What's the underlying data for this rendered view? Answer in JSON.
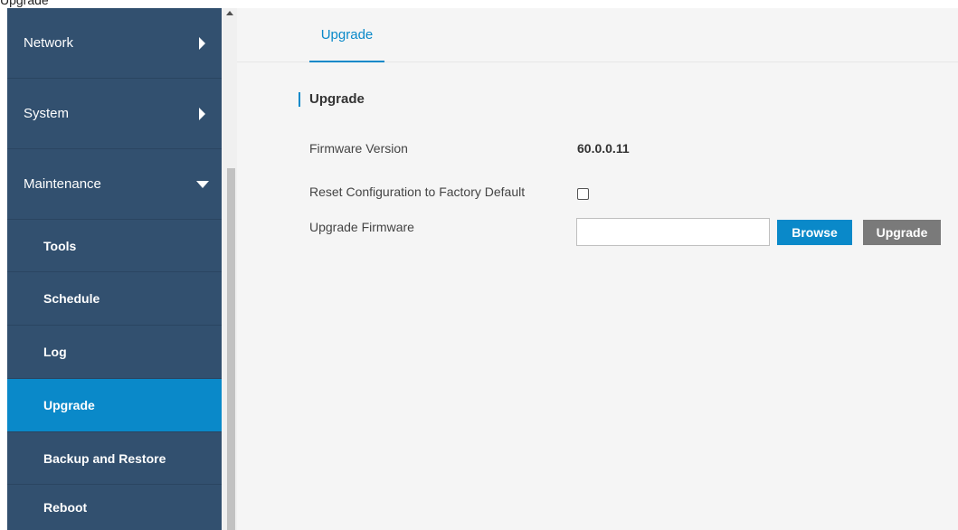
{
  "page": {
    "top_label": "Upgrade"
  },
  "sidebar": {
    "items": [
      {
        "label": "Network",
        "level": "top",
        "expander": "right"
      },
      {
        "label": "System",
        "level": "top",
        "expander": "right"
      },
      {
        "label": "Maintenance",
        "level": "top",
        "expander": "down"
      },
      {
        "label": "Tools",
        "level": "sub"
      },
      {
        "label": "Schedule",
        "level": "sub"
      },
      {
        "label": "Log",
        "level": "sub"
      },
      {
        "label": "Upgrade",
        "level": "sub",
        "active": true
      },
      {
        "label": "Backup and Restore",
        "level": "sub"
      },
      {
        "label": "Reboot",
        "level": "sub"
      }
    ]
  },
  "tabs": [
    {
      "label": "Upgrade",
      "active": true
    }
  ],
  "section": {
    "title": "Upgrade",
    "firmware_version_label": "Firmware Version",
    "firmware_version_value": "60.0.0.11",
    "reset_label": "Reset Configuration to Factory Default",
    "reset_checked": false,
    "upgrade_firmware_label": "Upgrade Firmware",
    "file_value": "",
    "browse_label": "Browse",
    "upgrade_label": "Upgrade"
  },
  "colors": {
    "sidebar_bg": "#32506f",
    "active_bg": "#0a89c9",
    "accent": "#0a89c9",
    "upgrade_button": "#7a7a7a"
  },
  "icons": {
    "network_expander": "caret-right-icon",
    "system_expander": "caret-right-icon",
    "maintenance_expander": "caret-down-icon",
    "scroll_up": "scroll-up-arrow-icon"
  }
}
